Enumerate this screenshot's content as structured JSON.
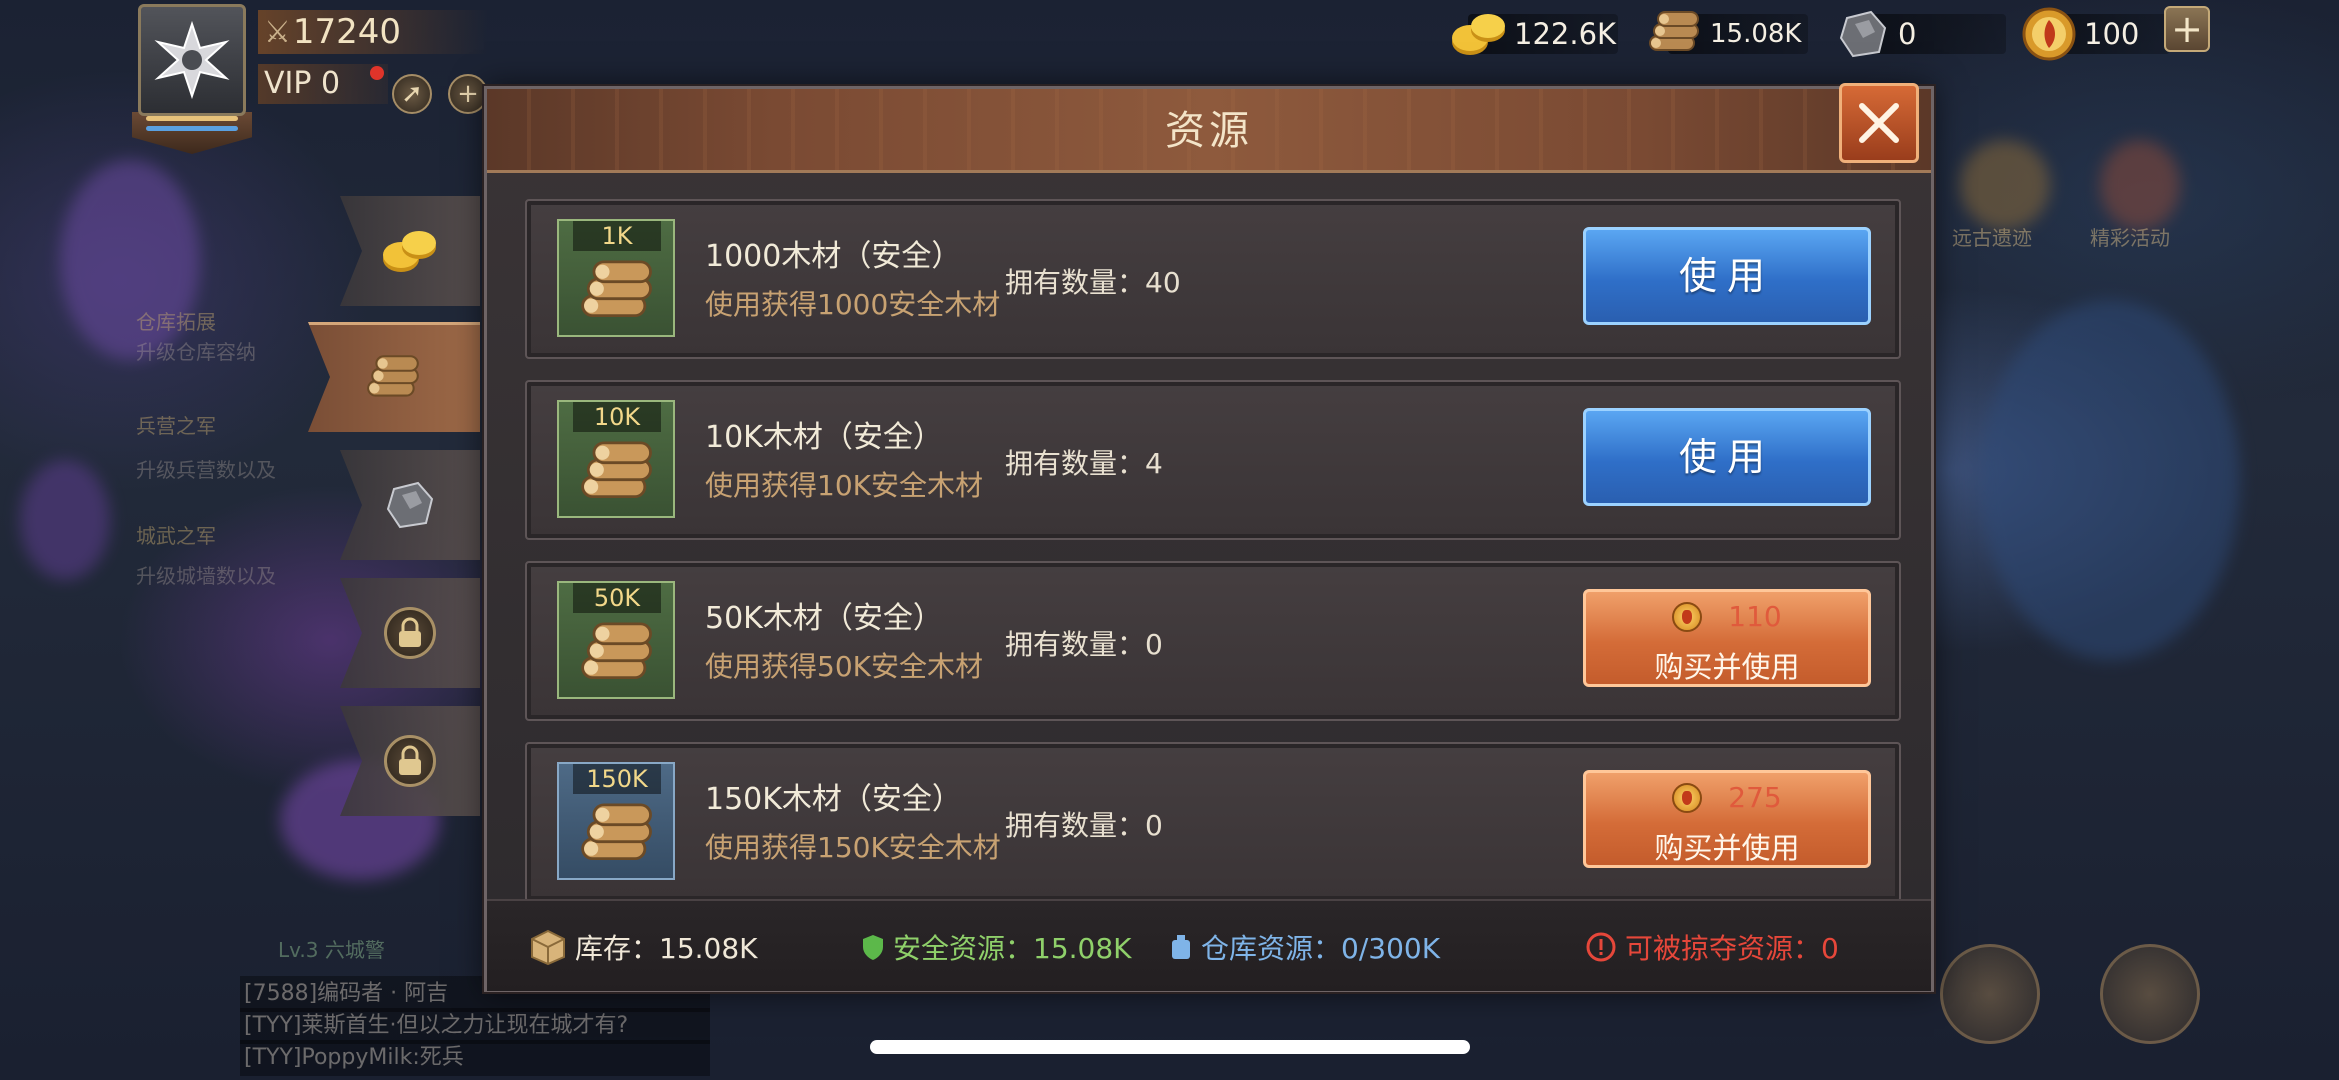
{
  "player": {
    "power": "17240",
    "vip": "VIP 0"
  },
  "resources": {
    "gold": "122.6K",
    "wood": "15.08K",
    "stone": "0",
    "gems": "100"
  },
  "background": {
    "left_texts": [
      "仓库拓展",
      "升级仓库容纳",
      "兵营之军",
      "升级兵营数以及",
      "城武之军",
      "升级城墙数以及"
    ],
    "chat_lines": [
      "[7588]编码者 · 阿吉",
      "[TYY]莱斯首生·但以之力让现在城才有?",
      "[TYY]PoppyMilk:死兵"
    ],
    "level_text": "Lv.3 六城警",
    "right_labels": [
      "远古遗迹",
      "精彩活动"
    ]
  },
  "dialog": {
    "title": "资源",
    "items": [
      {
        "tag": "1K",
        "name": "1000木材（安全）",
        "desc": "使用获得1000安全木材",
        "owned_label": "拥有数量：",
        "owned": "40",
        "action": "use",
        "action_label": "使用"
      },
      {
        "tag": "10K",
        "name": "10K木材（安全）",
        "desc": "使用获得10K安全木材",
        "owned_label": "拥有数量：",
        "owned": "4",
        "action": "use",
        "action_label": "使用"
      },
      {
        "tag": "50K",
        "name": "50K木材（安全）",
        "desc": "使用获得50K安全木材",
        "owned_label": "拥有数量：",
        "owned": "0",
        "action": "buy",
        "price": "110",
        "action_label": "购买并使用"
      },
      {
        "tag": "150K",
        "name": "150K木材（安全）",
        "desc": "使用获得150K安全木材",
        "owned_label": "拥有数量：",
        "owned": "0",
        "action": "buy",
        "price": "275",
        "action_label": "购买并使用"
      }
    ],
    "footer": {
      "stock": "库存：15.08K",
      "safe": "安全资源：15.08K",
      "warehouse": "仓库资源：0/300K",
      "plunderable": "可被掠夺资源：0"
    }
  },
  "colors": {
    "use_button": "#2f6fc8",
    "buy_button": "#d46c38",
    "price_red": "#e05a3c",
    "safe_green": "#8fd06a",
    "warehouse_blue": "#7fb4e8",
    "plunder_red": "#e6473a"
  },
  "icons": [
    "shield-emblem-icon",
    "crossed-swords-icon",
    "coins-icon",
    "logs-icon",
    "stone-icon",
    "gem-icon",
    "plus-icon",
    "close-icon",
    "lock-icon",
    "crate-icon",
    "shield-icon",
    "warehouse-icon",
    "warning-icon"
  ]
}
